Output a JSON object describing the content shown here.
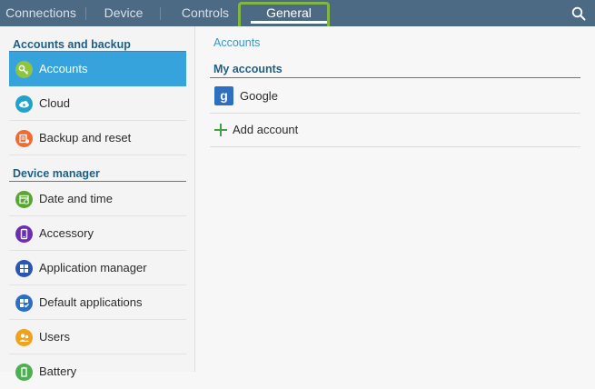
{
  "tabs": [
    {
      "label": "Connections"
    },
    {
      "label": "Device"
    },
    {
      "label": "Controls"
    },
    {
      "label": "General",
      "selected": true
    }
  ],
  "sidebar": {
    "sections": [
      {
        "title": "Accounts and backup"
      },
      {
        "title": "Device manager"
      }
    ],
    "items": [
      {
        "label": "Accounts",
        "icon": "key-icon",
        "color": "#8cc63f"
      },
      {
        "label": "Cloud",
        "icon": "cloud-icon",
        "color": "#1fa3c8"
      },
      {
        "label": "Backup and reset",
        "icon": "backup-icon",
        "color": "#f26a2e"
      },
      {
        "label": "Date and time",
        "icon": "calendar-icon",
        "color": "#5aa632"
      },
      {
        "label": "Accessory",
        "icon": "accessory-icon",
        "color": "#6a2db3"
      },
      {
        "label": "Application manager",
        "icon": "grid-icon",
        "color": "#2a55b5"
      },
      {
        "label": "Default applications",
        "icon": "apps-check-icon",
        "color": "#2a6fc4"
      },
      {
        "label": "Users",
        "icon": "users-icon",
        "color": "#f0a21e"
      },
      {
        "label": "Battery",
        "icon": "battery-icon",
        "color": "#4caf50"
      }
    ]
  },
  "main": {
    "breadcrumb": "Accounts",
    "section_title": "My accounts",
    "accounts": [
      {
        "label": "Google",
        "badge": "g",
        "icon": "google-icon",
        "color": "#2e6fc0"
      }
    ],
    "add_account_label": "Add account"
  },
  "colors": {
    "topbar": "#4d6a84",
    "accent": "#36a3dc",
    "highlight": "#7fb644",
    "annotation_arrow": "#f07a6a"
  }
}
